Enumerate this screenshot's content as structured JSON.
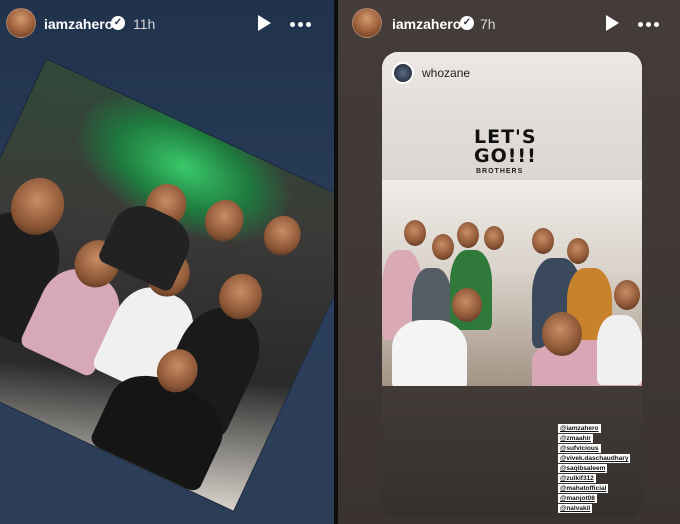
{
  "left_story": {
    "username": "iamzahero",
    "time": "11h"
  },
  "right_story": {
    "username": "iamzahero",
    "time": "7h",
    "reshared_post": {
      "username": "whozane",
      "headline": "LET'S GO!!!",
      "subheadline": "BROTHERS",
      "mentions": [
        "@iamzahero",
        "@zmaahir",
        "@sufvicious",
        "@vivek.daschaudhary",
        "@saqibsaleem",
        "@zulkif312",
        "@mahatofficial",
        "@manjot08",
        "@nalvakil"
      ]
    }
  },
  "icons": {
    "verified": "verified-badge-icon",
    "play": "play-icon",
    "more": "more-options-icon"
  },
  "colors": {
    "left_bg": "#2b3f5c",
    "right_bg": "#3f3835",
    "verified": "#ffffff"
  }
}
